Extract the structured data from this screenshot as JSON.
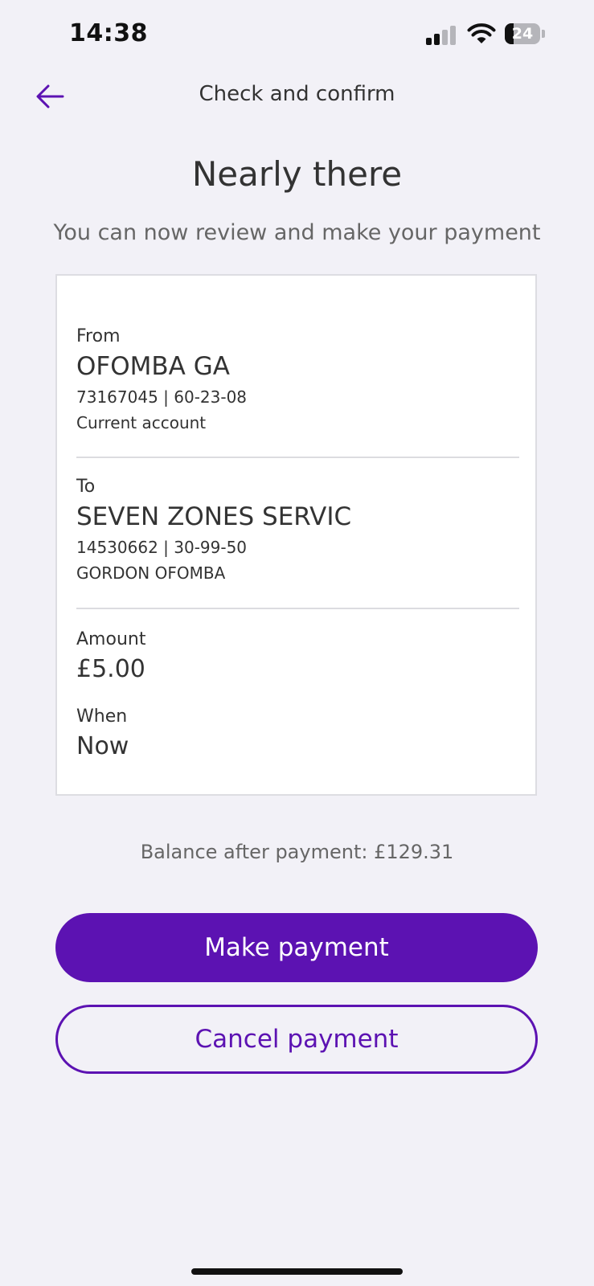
{
  "status_bar": {
    "time": "14:38",
    "battery_level": "24",
    "battery_fraction": 0.24,
    "icons": [
      "signal-icon",
      "wifi-icon",
      "battery-icon"
    ]
  },
  "header": {
    "title": "Check and confirm",
    "back_icon": "arrow-left-icon"
  },
  "page": {
    "title": "Nearly there",
    "subtitle": "You can now review and make your payment"
  },
  "payment": {
    "from": {
      "label": "From",
      "name": "OFOMBA GA",
      "account_details": "73167045 | 60-23-08",
      "account_type": "Current account"
    },
    "to": {
      "label": "To",
      "name": "SEVEN ZONES SERVIC",
      "account_details": "14530662 | 30-99-50",
      "reference": "GORDON OFOMBA"
    },
    "amount": {
      "label": "Amount",
      "value": "£5.00"
    },
    "when": {
      "label": "When",
      "value": "Now"
    }
  },
  "balance_text": "Balance after payment: £129.31",
  "actions": {
    "primary_label": "Make payment",
    "secondary_label": "Cancel payment"
  },
  "colors": {
    "accent": "#5c12b2",
    "background": "#f2f1f7",
    "card": "#ffffff",
    "text": "#333333",
    "muted_text": "#666666"
  }
}
